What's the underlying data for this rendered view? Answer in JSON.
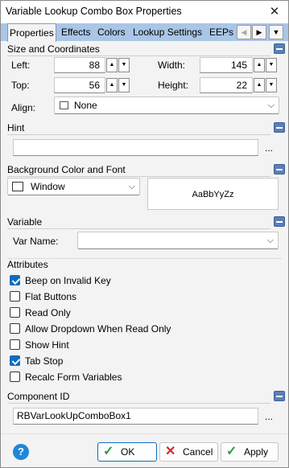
{
  "window": {
    "title": "Variable Lookup Combo Box Properties",
    "close_glyph": "✕"
  },
  "tabs": [
    {
      "label": "Properties",
      "active": true
    },
    {
      "label": "Effects"
    },
    {
      "label": "Colors"
    },
    {
      "label": "Lookup Settings"
    },
    {
      "label": "EEPs"
    }
  ],
  "tab_scroll": {
    "left": "◀",
    "right": "▶",
    "menu": "▼"
  },
  "size": {
    "header": "Size and Coordinates",
    "left_label": "Left:",
    "left_value": "88",
    "top_label": "Top:",
    "top_value": "56",
    "width_label": "Width:",
    "width_value": "145",
    "height_label": "Height:",
    "height_value": "22",
    "align_label": "Align:",
    "align_value": "None",
    "spin_glyph": "▲▼"
  },
  "hint": {
    "header": "Hint",
    "value": "",
    "ellipsis": "..."
  },
  "background": {
    "header": "Background Color and Font",
    "color_value": "Window",
    "font_sample": "AaBbYyZz"
  },
  "variable": {
    "header": "Variable",
    "var_name_label": "Var Name:",
    "var_name_value": ""
  },
  "attributes": {
    "header": "Attributes",
    "items": [
      {
        "label": "Beep on Invalid Key",
        "checked": true
      },
      {
        "label": "Flat Buttons",
        "checked": false
      },
      {
        "label": "Read Only",
        "checked": false
      },
      {
        "label": "Allow Dropdown When Read Only",
        "checked": false
      },
      {
        "label": "Show Hint",
        "checked": false
      },
      {
        "label": "Tab Stop",
        "checked": true
      },
      {
        "label": "Recalc Form Variables",
        "checked": false
      }
    ]
  },
  "component": {
    "header": "Component ID",
    "value": "RBVarLookUpComboBox1",
    "ellipsis": "..."
  },
  "buttons": {
    "ok": "OK",
    "cancel": "Cancel",
    "apply": "Apply",
    "help": "?"
  },
  "colors": {
    "tab_bar": "#a9c6e6",
    "accent": "#0f6cbd",
    "ok_icon": "#2e9c3e",
    "cancel_icon": "#d42a2a",
    "help": "#1e88d8"
  }
}
